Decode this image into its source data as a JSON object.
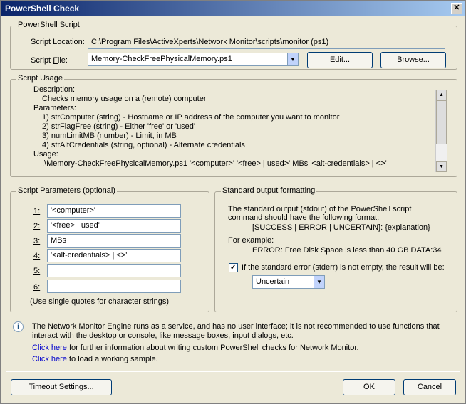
{
  "window": {
    "title": "PowerShell Check"
  },
  "script_group": {
    "legend": "PowerShell Script",
    "location_label": "Script Location:",
    "location_value": "C:\\Program Files\\ActiveXperts\\Network Monitor\\scripts\\monitor (ps1)",
    "file_label": "Script File:",
    "file_value": "Memory-CheckFreePhysicalMemory.ps1",
    "edit_button": "Edit...",
    "browse_button": "Browse..."
  },
  "usage_group": {
    "legend": "Script Usage",
    "lines": [
      "Description:",
      "Checks memory usage on a (remote) computer",
      "Parameters:",
      "1) strComputer (string)  - Hostname or IP address of the computer you want to monitor",
      "2) strFlagFree (string)  - Either 'free' or 'used'",
      "3) numLimitMB (number)    - Limit, in MB",
      "4) strAltCredentials (string, optional) - Alternate credentials",
      "Usage:",
      ".\\Memory-CheckFreePhysicalMemory.ps1 '<computer>' '<free> | used>' MBs '<alt-credentials> | <>'"
    ]
  },
  "params_group": {
    "legend": "Script Parameters (optional)",
    "labels": [
      "1:",
      "2:",
      "3:",
      "4:",
      "5:",
      "6:"
    ],
    "values": [
      "'<computer>'",
      "'<free> | used'",
      "MBs",
      "'<alt-credentials> | <>'",
      "",
      ""
    ],
    "hint": "(Use single quotes for character strings)"
  },
  "output_group": {
    "legend": "Standard output formatting",
    "text1": "The standard output (stdout) of the PowerShell script",
    "text2": "command should have the following format:",
    "format": "[SUCCESS | ERROR | UNCERTAIN]: {explanation}",
    "example_label": "For example:",
    "example": "ERROR: Free Disk Space is less than 40 GB DATA:34",
    "stderr_label": "If the standard error (stderr) is not empty, the result will be:",
    "stderr_checked": true,
    "stderr_value": "Uncertain"
  },
  "info": {
    "text1": "The Network Monitor Engine runs as a service, and has no user interface; it is not recommended to use functions that",
    "text2": "interact with the desktop or console, like message boxes, input dialogs, etc.",
    "link1": "Click here",
    "link1_text": " for further information about writing custom PowerShell checks for Network Monitor.",
    "link2": "Click here",
    "link2_text": " to load a working sample."
  },
  "buttons": {
    "timeout": "Timeout Settings...",
    "ok": "OK",
    "cancel": "Cancel"
  }
}
